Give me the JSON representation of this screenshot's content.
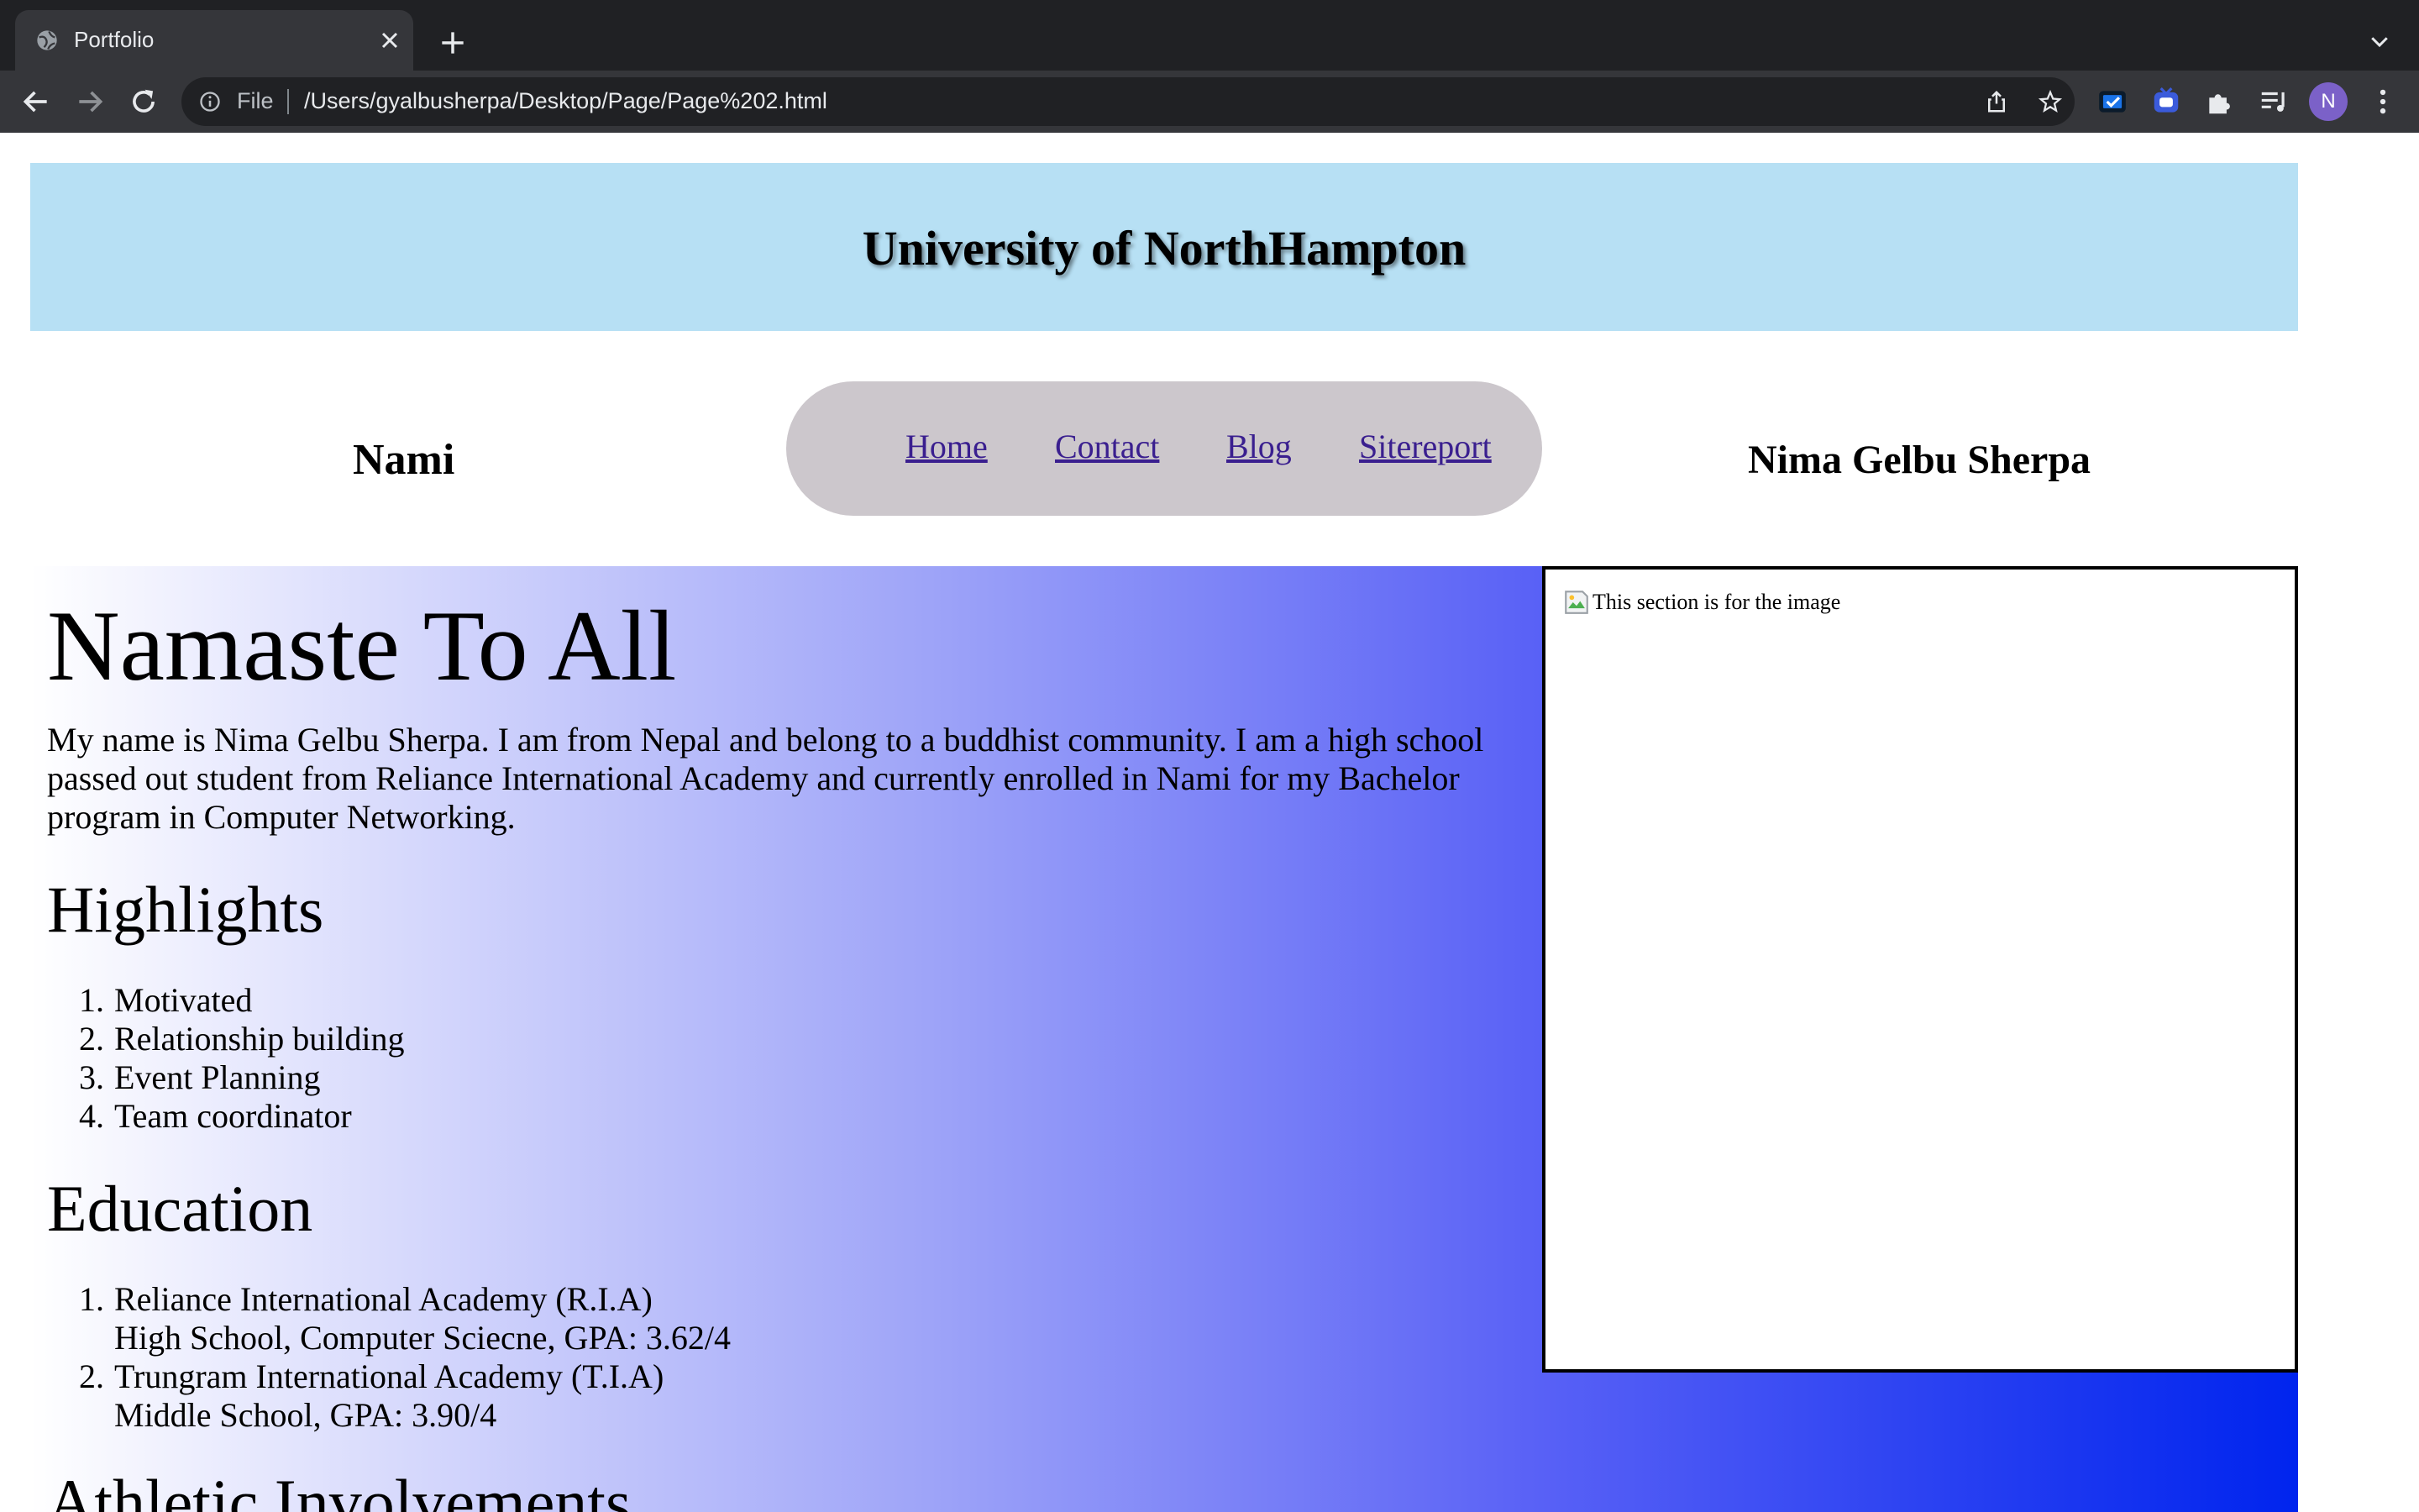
{
  "browser": {
    "tab_title": "Portfolio",
    "omnibox_scheme": "File",
    "url": "/Users/gyalbusherpa/Desktop/Page/Page%202.html",
    "profile_initial": "N"
  },
  "page": {
    "banner_title": "University of NorthHampton",
    "brand_left": "Nami",
    "brand_right": "Nima Gelbu Sherpa",
    "nav": [
      "Home",
      "Contact",
      "Blog",
      "Sitereport"
    ],
    "greeting": "Namaste To All",
    "intro": "My name is Nima Gelbu Sherpa. I am from Nepal and belong to a buddhist community. I am a high school passed out student from Reliance International Academy and currently enrolled in Nami for my Bachelor program in Computer Networking.",
    "highlights_heading": "Highlights",
    "highlights": [
      "Motivated",
      "Relationship building",
      "Event Planning",
      "Team coordinator"
    ],
    "education_heading": "Education",
    "education": [
      {
        "num": "1.",
        "school": "Reliance International Academy (R.I.A)",
        "detail": "High School, Computer Sciecne, GPA: 3.62/4"
      },
      {
        "num": "2.",
        "school": "Trungram International Academy (T.I.A)",
        "detail": "Middle School, GPA: 3.90/4"
      }
    ],
    "athletic_heading": "Athletic Involvements",
    "image_alt": "This section is for the image"
  },
  "list_numbers": [
    "1.",
    "2.",
    "3.",
    "4."
  ],
  "colors": {
    "banner": "#b7e0f4",
    "nav_pill": "#ccc7cc",
    "link": "#3a1f8f",
    "gradient_start": "#ffffff",
    "gradient_end": "#0024ee"
  }
}
